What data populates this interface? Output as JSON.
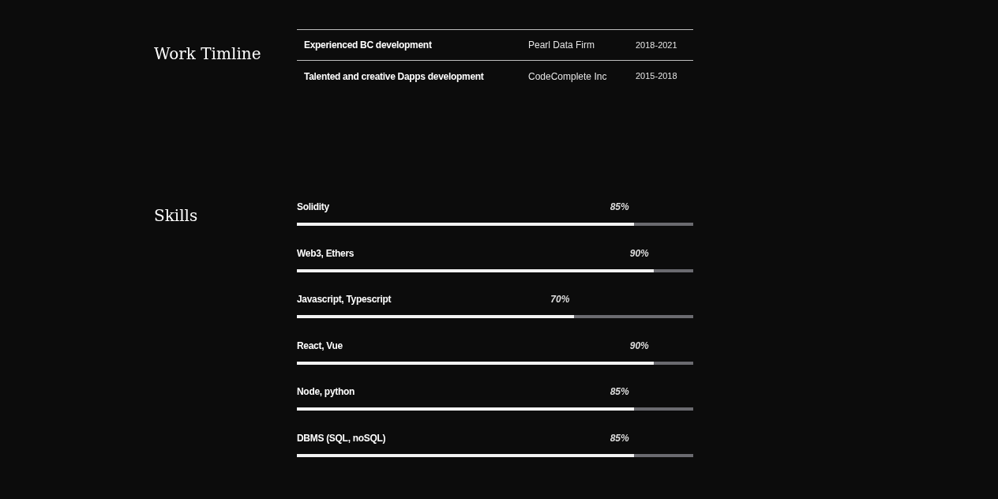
{
  "work_timeline": {
    "heading": "Work Timline",
    "rows": [
      {
        "role": "Experienced BC development",
        "company": "Pearl Data Firm",
        "period": "2018-2021"
      },
      {
        "role": "Talented and creative Dapps development",
        "company": "CodeComplete Inc",
        "period": "2015-2018"
      }
    ]
  },
  "skills": {
    "heading": "Skills",
    "items": [
      {
        "name": "Solidity",
        "reading": "85%",
        "level": 0.85
      },
      {
        "name": "Web3, Ethers",
        "reading": "90%",
        "level": 0.9
      },
      {
        "name": "Javascript, Typescript",
        "reading": "70%",
        "level": 0.7
      },
      {
        "name": "React, Vue",
        "reading": "90%",
        "level": 0.9
      },
      {
        "name": "Node, python",
        "reading": "85%",
        "level": 0.85
      },
      {
        "name": "DBMS (SQL, noSQL)",
        "reading": "85%",
        "level": 0.85
      }
    ]
  }
}
